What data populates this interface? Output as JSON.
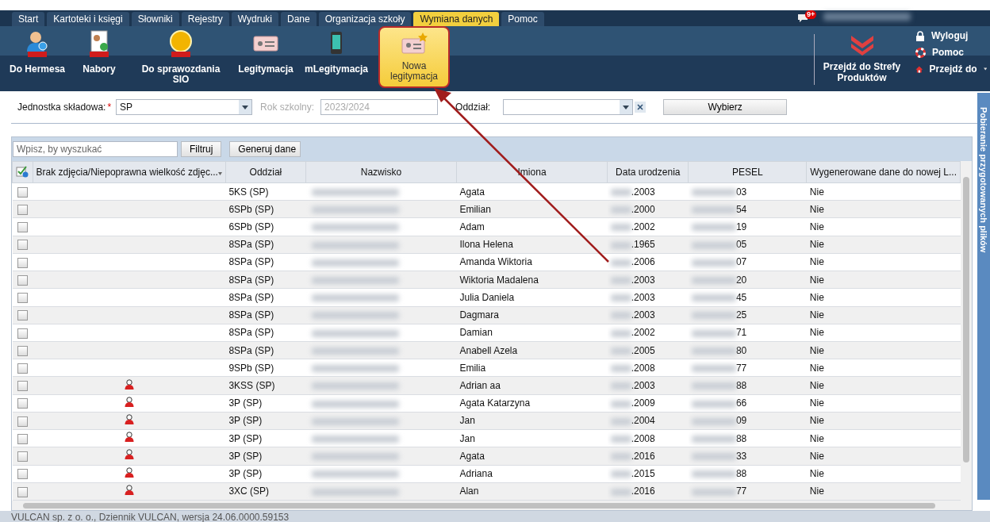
{
  "menu": [
    {
      "label": "Start",
      "selected": false
    },
    {
      "label": "Kartoteki i księgi",
      "selected": false
    },
    {
      "label": "Słowniki",
      "selected": false
    },
    {
      "label": "Rejestry",
      "selected": false
    },
    {
      "label": "Wydruki",
      "selected": false
    },
    {
      "label": "Dane",
      "selected": false
    },
    {
      "label": "Organizacja szkoły",
      "selected": false
    },
    {
      "label": "Wymiana danych",
      "selected": true
    },
    {
      "label": "Pomoc",
      "selected": false
    }
  ],
  "notifications": {
    "badge": "9+"
  },
  "toolbar": [
    {
      "kind": "hermes",
      "label": "Do Hermesa",
      "selected": false
    },
    {
      "kind": "nabory",
      "label": "Nabory",
      "selected": false
    },
    {
      "kind": "sio",
      "label": "Do sprawozdania SIO",
      "selected": false
    },
    {
      "kind": "card",
      "label": "Legitymacja",
      "selected": false
    },
    {
      "kind": "phone",
      "label": "mLegitymacja",
      "selected": false
    },
    {
      "kind": "newcard",
      "label": "Nowa legitymacja",
      "selected": true
    }
  ],
  "products": {
    "label": "Przejdź do Strefy Produktów"
  },
  "user_links": [
    {
      "kind": "lock",
      "label": "Wyloguj"
    },
    {
      "kind": "help",
      "label": "Pomoc"
    },
    {
      "kind": "home",
      "label": "Przejdź do"
    }
  ],
  "filters": {
    "unit_label": "Jednostka składowa:",
    "unit_required": "*",
    "unit_value": "SP",
    "year_label": "Rok szkolny:",
    "year_value": "2023/2024",
    "class_label": "Oddział:",
    "select_button": "Wybierz"
  },
  "grid_toolbar": {
    "search_placeholder": "Wpisz, by wyszukać",
    "filter_button": "Filtruj",
    "generate_button": "Generuj dane"
  },
  "table": {
    "columns": [
      "Brak zdjęcia/Niepoprawna wielkość zdjęc...",
      "Oddział",
      "Nazwisko",
      "Imiona",
      "Data urodzenia",
      "PESEL",
      "Wygenerowane dane do nowej L..."
    ],
    "rows": [
      {
        "checked": false,
        "photo_warning": false,
        "class": "5KS (SP)",
        "first_names": "Agata",
        "birth_date": ".2003",
        "pesel": "03",
        "generated": "Nie"
      },
      {
        "checked": false,
        "photo_warning": false,
        "class": "6SPb (SP)",
        "first_names": "Emilian",
        "birth_date": ".2000",
        "pesel": "54",
        "generated": "Nie"
      },
      {
        "checked": false,
        "photo_warning": false,
        "class": "6SPb (SP)",
        "first_names": "Adam",
        "birth_date": ".2002",
        "pesel": "19",
        "generated": "Nie"
      },
      {
        "checked": false,
        "photo_warning": false,
        "class": "8SPa (SP)",
        "first_names": "Ilona Helena",
        "birth_date": ".1965",
        "pesel": "05",
        "generated": "Nie"
      },
      {
        "checked": false,
        "photo_warning": false,
        "class": "8SPa (SP)",
        "first_names": "Amanda Wiktoria",
        "birth_date": ".2006",
        "pesel": "07",
        "generated": "Nie"
      },
      {
        "checked": false,
        "photo_warning": false,
        "class": "8SPa (SP)",
        "first_names": "Wiktoria Madalena",
        "birth_date": ".2003",
        "pesel": "20",
        "generated": "Nie"
      },
      {
        "checked": false,
        "photo_warning": false,
        "class": "8SPa (SP)",
        "first_names": "Julia Daniela",
        "birth_date": ".2003",
        "pesel": "45",
        "generated": "Nie"
      },
      {
        "checked": false,
        "photo_warning": false,
        "class": "8SPa (SP)",
        "first_names": "Dagmara",
        "birth_date": ".2003",
        "pesel": "25",
        "generated": "Nie"
      },
      {
        "checked": false,
        "photo_warning": false,
        "class": "8SPa (SP)",
        "first_names": "Damian",
        "birth_date": ".2002",
        "pesel": "71",
        "generated": "Nie"
      },
      {
        "checked": false,
        "photo_warning": false,
        "class": "8SPa (SP)",
        "first_names": "Anabell Azela",
        "birth_date": ".2005",
        "pesel": "80",
        "generated": "Nie"
      },
      {
        "checked": false,
        "photo_warning": false,
        "class": "9SPb (SP)",
        "first_names": "Emilia",
        "birth_date": ".2008",
        "pesel": "77",
        "generated": "Nie"
      },
      {
        "checked": false,
        "photo_warning": true,
        "class": "3KSS (SP)",
        "first_names": "Adrian aa",
        "birth_date": ".2003",
        "pesel": "88",
        "generated": "Nie"
      },
      {
        "checked": false,
        "photo_warning": true,
        "class": "3P (SP)",
        "first_names": "Agata Katarzyna",
        "birth_date": ".2009",
        "pesel": "66",
        "generated": "Nie"
      },
      {
        "checked": false,
        "photo_warning": true,
        "class": "3P (SP)",
        "first_names": "Jan",
        "birth_date": ".2004",
        "pesel": "09",
        "generated": "Nie"
      },
      {
        "checked": false,
        "photo_warning": true,
        "class": "3P (SP)",
        "first_names": "Jan",
        "birth_date": ".2008",
        "pesel": "88",
        "generated": "Nie"
      },
      {
        "checked": false,
        "photo_warning": true,
        "class": "3P (SP)",
        "first_names": "Agata",
        "birth_date": ".2016",
        "pesel": "33",
        "generated": "Nie"
      },
      {
        "checked": false,
        "photo_warning": true,
        "class": "3P (SP)",
        "first_names": "Adriana",
        "birth_date": ".2015",
        "pesel": "88",
        "generated": "Nie"
      },
      {
        "checked": false,
        "photo_warning": true,
        "class": "3XC (SP)",
        "first_names": "Alan",
        "birth_date": ".2016",
        "pesel": "77",
        "generated": "Nie"
      }
    ]
  },
  "side_panel": {
    "label": "Pobieranie przygotowanych plików"
  },
  "footer": "VULCAN sp. z o. o., Dziennik VULCAN, wersja 24.06.0000.59153"
}
